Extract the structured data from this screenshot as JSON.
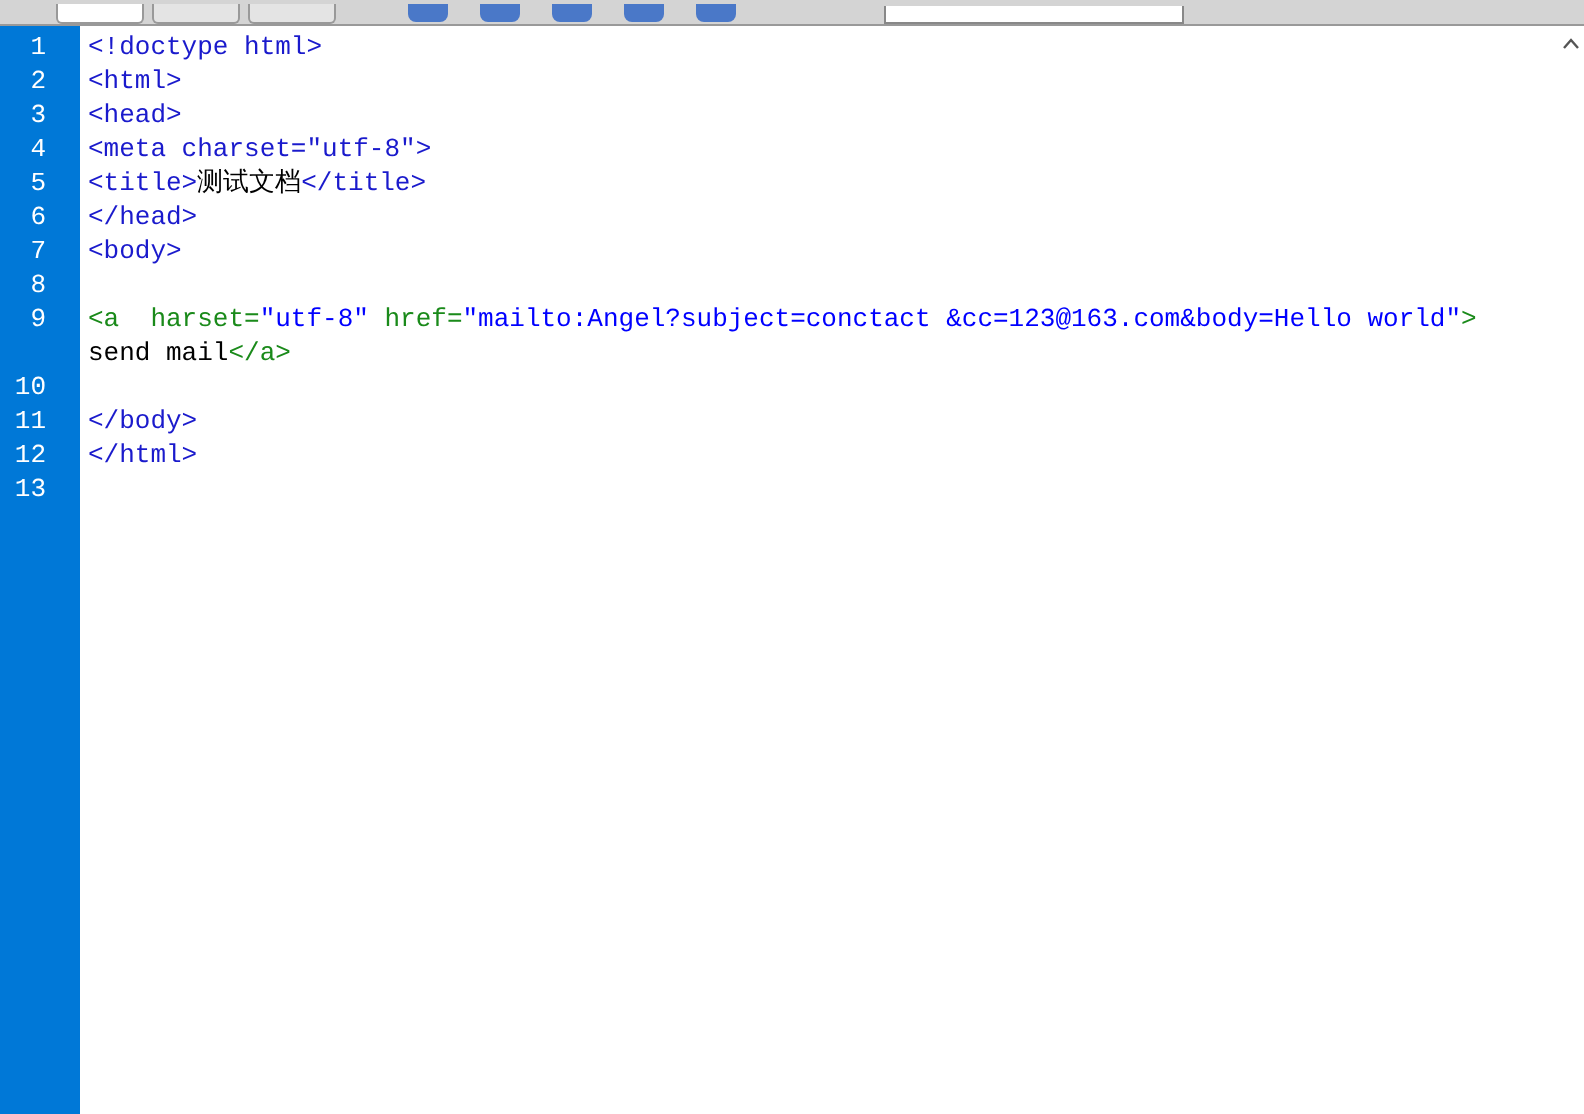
{
  "toolbar": {
    "view_buttons": [
      {
        "selected": true
      },
      {
        "selected": false
      },
      {
        "selected": false
      }
    ]
  },
  "editor": {
    "lines": [
      {
        "number": "1",
        "rows": [
          [
            {
              "kind": "tag",
              "text": "<!doctype html>"
            }
          ]
        ]
      },
      {
        "number": "2",
        "rows": [
          [
            {
              "kind": "tag",
              "text": "<html>"
            }
          ]
        ]
      },
      {
        "number": "3",
        "rows": [
          [
            {
              "kind": "tag",
              "text": "<head>"
            }
          ]
        ]
      },
      {
        "number": "4",
        "rows": [
          [
            {
              "kind": "tag",
              "text": "<meta charset=\"utf-8\">"
            }
          ]
        ]
      },
      {
        "number": "5",
        "rows": [
          [
            {
              "kind": "tag",
              "text": "<title>"
            },
            {
              "kind": "text",
              "text": "测试文档"
            },
            {
              "kind": "tag",
              "text": "</title>"
            }
          ]
        ]
      },
      {
        "number": "6",
        "rows": [
          [
            {
              "kind": "tag",
              "text": "</head>"
            }
          ]
        ]
      },
      {
        "number": "7",
        "rows": [
          [
            {
              "kind": "tag",
              "text": "<body>"
            }
          ]
        ]
      },
      {
        "number": "8",
        "rows": [
          []
        ]
      },
      {
        "number": "9",
        "rows": [
          [
            {
              "kind": "anchor",
              "text": "<a  harset="
            },
            {
              "kind": "string",
              "text": "\"utf-8\""
            },
            {
              "kind": "anchor",
              "text": " href="
            },
            {
              "kind": "string",
              "text": "\"mailto:Angel?subject=conctact &cc=123@163.com&body=Hello world\""
            },
            {
              "kind": "anchor",
              "text": ">"
            }
          ],
          [
            {
              "kind": "text",
              "text": "send mail"
            },
            {
              "kind": "anchor",
              "text": "</a>"
            }
          ]
        ]
      },
      {
        "number": "10",
        "rows": [
          []
        ]
      },
      {
        "number": "11",
        "rows": [
          [
            {
              "kind": "tag",
              "text": "</body>"
            }
          ]
        ]
      },
      {
        "number": "12",
        "rows": [
          [
            {
              "kind": "tag",
              "text": "</html>"
            }
          ]
        ]
      },
      {
        "number": "13",
        "rows": [
          []
        ]
      }
    ]
  }
}
